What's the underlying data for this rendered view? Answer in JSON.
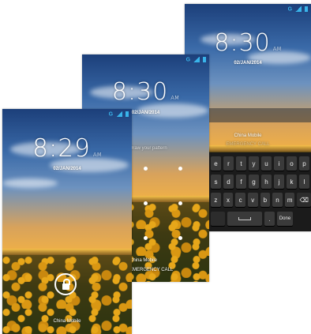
{
  "colors": {
    "accent": "#39b4ea"
  },
  "status_bar": {
    "network": "G",
    "signal_icon": "signal-icon",
    "battery_icon": "battery-icon"
  },
  "screen_right": {
    "time": "8:30",
    "ampm": "AM",
    "date": "02/JAN/2014",
    "carrier": "China Mobile",
    "emergency": "EMERGENCY CALL",
    "keyboard": {
      "row1": [
        "e",
        "r",
        "t",
        "y",
        "u",
        "i",
        "o",
        "p"
      ],
      "row2": [
        "s",
        "d",
        "f",
        "g",
        "h",
        "j",
        "k",
        "l"
      ],
      "row3": [
        "z",
        "x",
        "c",
        "v",
        "b",
        "n",
        "m"
      ],
      "row3_icon": "backspace-icon",
      "row4_left": "",
      "row4_dot": ".",
      "row4_done": "Done"
    }
  },
  "screen_middle": {
    "time": "8:30",
    "ampm": "AM",
    "date": "02/JAN/2014",
    "pattern_prompt": "Draw your pattern",
    "carrier": "China Mobile",
    "emergency": "EMERGENCY CALL"
  },
  "screen_left": {
    "time": "8:29",
    "ampm": "AM",
    "date": "02/JAN/2014",
    "carrier": "China Mobile",
    "unlock_icon": "lock-icon"
  }
}
